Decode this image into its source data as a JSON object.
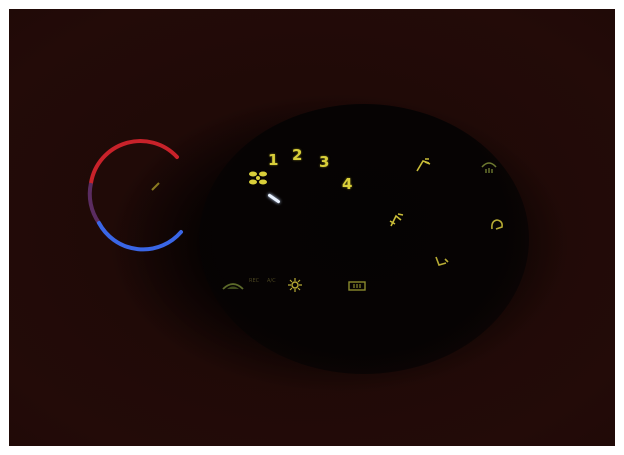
{
  "scene": {
    "colors": {
      "background": "#221008",
      "panel": "#050303",
      "hot": "#d8262a",
      "cold": "#3a66e6",
      "glyph": "#d9cf3a",
      "needle": "#e8f1ff"
    }
  },
  "temperature_dial": {
    "icons": [
      "temperature-arc-icon",
      "temperature-indicator-icon"
    ]
  },
  "fan_dial": {
    "speeds": [
      "1",
      "2",
      "3",
      "4"
    ],
    "icon": "fan-icon"
  },
  "mode_dial": {
    "icons": [
      "face-vent-icon",
      "defrost-icon",
      "face-feet-vent-icon",
      "foot-defrost-icon",
      "feet-vent-icon"
    ]
  },
  "bottom_buttons": {
    "icons": [
      "recirculation-icon",
      "ac-snowflake-icon",
      "rear-defrost-icon"
    ],
    "labels": [
      "REC",
      "A/C"
    ]
  }
}
